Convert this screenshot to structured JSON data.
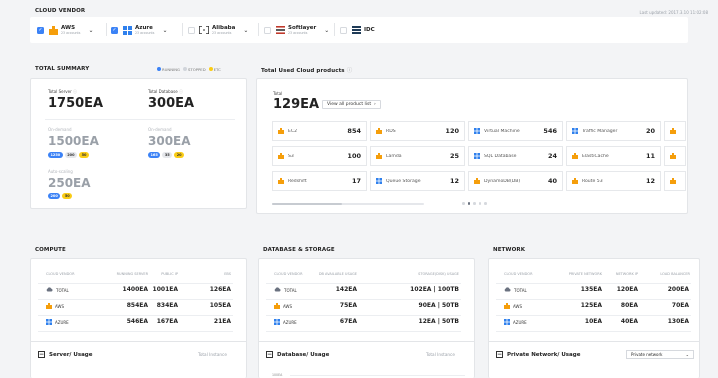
{
  "header": {
    "title": "CLOUD VENDOR",
    "updated": "Last updated: 2017.3.10 11:02:08"
  },
  "vendors": [
    {
      "name": "AWS",
      "sub": "23 accounts",
      "checked": true,
      "logo": "aws-icon"
    },
    {
      "name": "Azure",
      "sub": "23 accounts",
      "checked": true,
      "logo": "azure-icon"
    },
    {
      "name": "Alibaba",
      "sub": "23 accounts",
      "checked": false,
      "logo": "alibaba-icon"
    },
    {
      "name": "Softlayer",
      "sub": "23 accounts",
      "checked": false,
      "logo": "softlayer-icon"
    },
    {
      "name": "IDC",
      "sub": "",
      "checked": false,
      "logo": "idc-icon"
    }
  ],
  "summary": {
    "title": "TOTAL SUMMARY",
    "legend": {
      "running": "RUNNING",
      "stopped": "STOPPED",
      "etc": "ETC"
    },
    "server_label": "Total Server",
    "server_value": "1750EA",
    "database_label": "Total Database",
    "database_value": "300EA",
    "ondemand_label": "On-demand",
    "ondemand_server": "1500EA",
    "ondemand_server_pills": [
      "1250",
      "200",
      "50"
    ],
    "ondemand_db": "300EA",
    "ondemand_db_pills": [
      "165",
      "35",
      "20"
    ],
    "autoscaling_label": "Auto-scaling",
    "autoscaling_value": "250EA",
    "autoscaling_pills": [
      "200",
      "50"
    ]
  },
  "products": {
    "title": "Total Used Cloud products",
    "total_label": "Total",
    "total_value": "129EA",
    "view_all": "View all product list",
    "items": [
      {
        "name": "EC2",
        "value": "854",
        "icon": "aws-icon"
      },
      {
        "name": "RDS",
        "value": "120",
        "icon": "aws-icon"
      },
      {
        "name": "Virtual Machine",
        "value": "546",
        "icon": "azure-icon"
      },
      {
        "name": "Traffic Manager",
        "value": "20",
        "icon": "azure-icon"
      },
      {
        "name": "S3",
        "value": "100",
        "icon": "aws-icon"
      },
      {
        "name": "Lamda",
        "value": "25",
        "icon": "aws-icon"
      },
      {
        "name": "SQL Database",
        "value": "24",
        "icon": "azure-icon"
      },
      {
        "name": "ElastiCache",
        "value": "11",
        "icon": "aws-icon"
      },
      {
        "name": "Redshift",
        "value": "17",
        "icon": "aws-icon"
      },
      {
        "name": "Queue Storage",
        "value": "12",
        "icon": "azure-icon"
      },
      {
        "name": "DynamoDB(DB)",
        "value": "40",
        "icon": "aws-icon"
      },
      {
        "name": "Route 53",
        "value": "12",
        "icon": "aws-icon"
      }
    ]
  },
  "compute": {
    "title": "COMPUTE",
    "headers": [
      "CLOUD VENDOR",
      "RUNNING SERVER",
      "PUBLIC IP",
      "EBS"
    ],
    "rows": [
      {
        "vendor": "TOTAL",
        "icon": "cloud-icon",
        "c1": "1400EA",
        "c2": "1001EA",
        "c3": "126EA"
      },
      {
        "vendor": "AWS",
        "icon": "aws-icon",
        "c1": "854EA",
        "c2": "834EA",
        "c3": "105EA"
      },
      {
        "vendor": "AZURE",
        "icon": "azure-icon",
        "c1": "546EA",
        "c2": "167EA",
        "c3": "21EA"
      }
    ],
    "usage_title": "Server/ Usage",
    "usage_right": "Total Instance"
  },
  "database": {
    "title": "DATABASE & STORAGE",
    "headers": [
      "CLOUD VENDOR",
      "DB AVAILABLE USAGE",
      "STORAGE(DISK) USAGE"
    ],
    "rows": [
      {
        "vendor": "TOTAL",
        "icon": "cloud-icon",
        "c1": "142EA",
        "c2": "102EA | 100TB"
      },
      {
        "vendor": "AWS",
        "icon": "aws-icon",
        "c1": "75EA",
        "c2": "90EA | 50TB"
      },
      {
        "vendor": "AZURE",
        "icon": "azure-icon",
        "c1": "67EA",
        "c2": "12EA | 50TB"
      }
    ],
    "usage_title": "Database/ Usage",
    "usage_right": "Total Instance",
    "axis_label": "100EA"
  },
  "network": {
    "title": "NETWORK",
    "headers": [
      "CLOUD VENDOR",
      "PRIVATE NETWORK",
      "NETWORK IP",
      "LOAD BALANCER"
    ],
    "rows": [
      {
        "vendor": "TOTAL",
        "icon": "cloud-icon",
        "c1": "135EA",
        "c2": "120EA",
        "c3": "200EA"
      },
      {
        "vendor": "AWS",
        "icon": "aws-icon",
        "c1": "125EA",
        "c2": "80EA",
        "c3": "70EA"
      },
      {
        "vendor": "AZURE",
        "icon": "azure-icon",
        "c1": "10EA",
        "c2": "40EA",
        "c3": "130EA"
      }
    ],
    "usage_title": "Private Network/ Usage",
    "select_value": "Private network"
  },
  "colors": {
    "running": "#3b82f6",
    "stopped": "#d1d5db",
    "etc": "#facc15",
    "aws": "#f59e0b",
    "azure": "#2f80ed"
  }
}
